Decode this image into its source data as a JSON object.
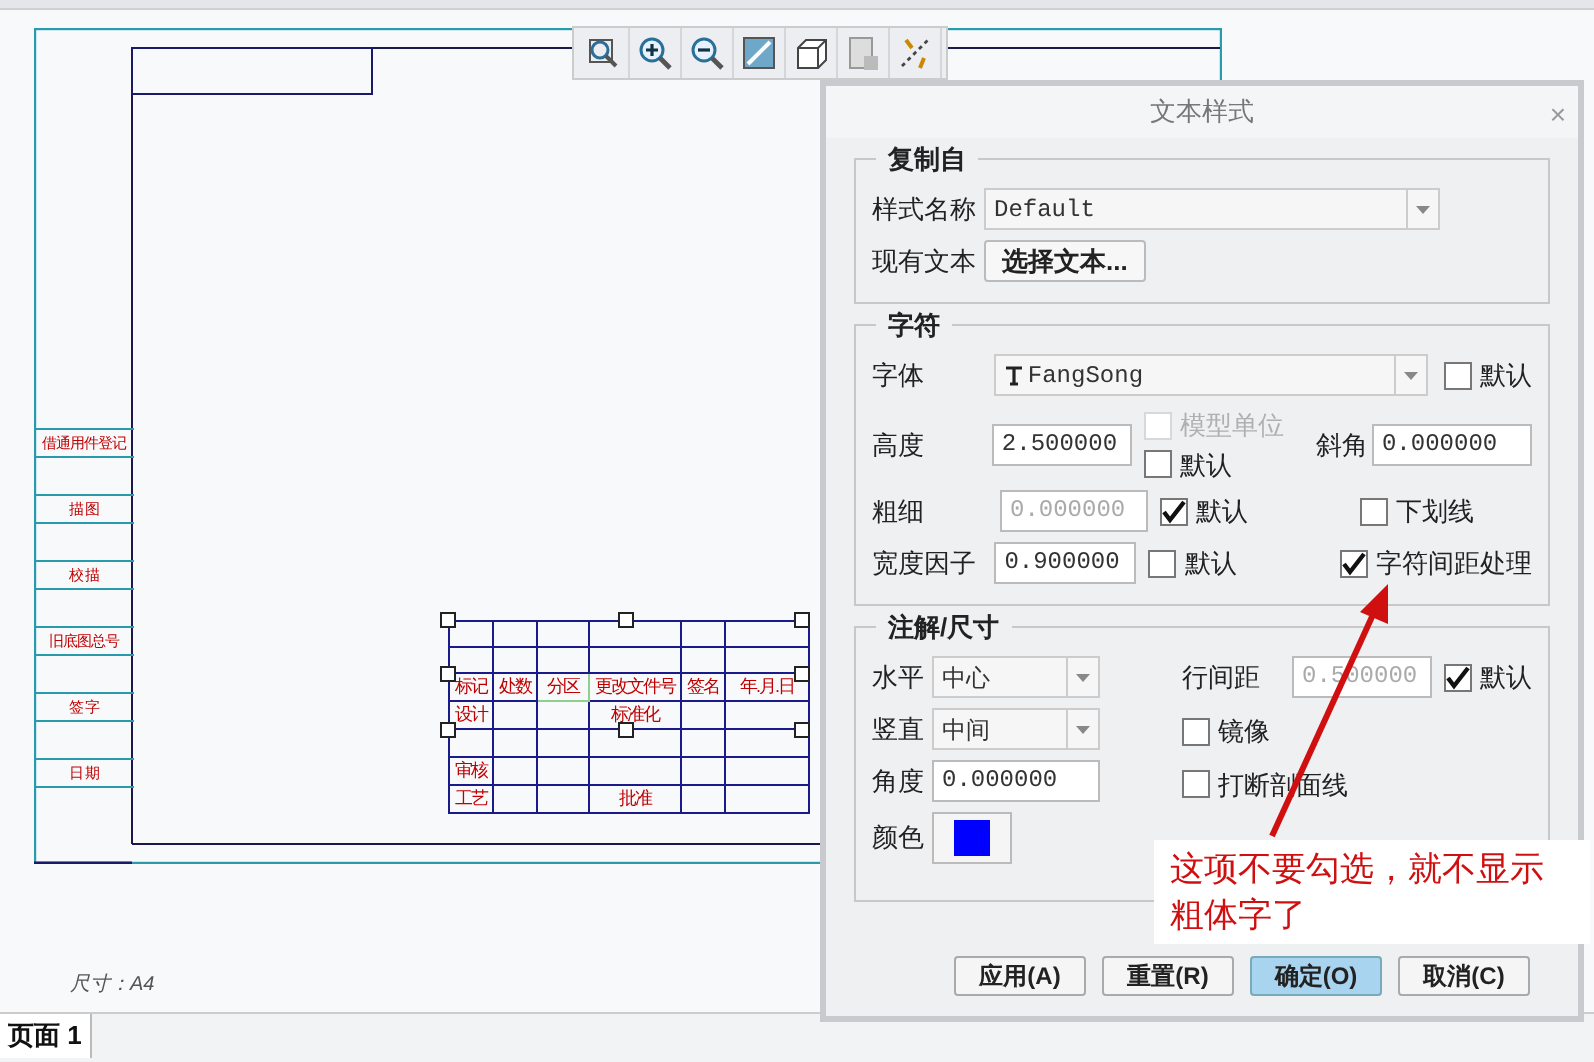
{
  "sheet": {
    "side_labels": [
      "借通用件登记",
      "描 图",
      "校 描",
      "旧底图总号",
      "签 字",
      "日 期"
    ],
    "title_block": {
      "header": [
        "标记",
        "处数",
        "分区",
        "更改文件号",
        "签名",
        "年.月.日"
      ],
      "rows": [
        [
          "设计",
          "",
          "",
          "标准化",
          "",
          ""
        ],
        [
          "",
          "",
          "",
          "",
          "",
          ""
        ],
        [
          "审核",
          "",
          "",
          "",
          "",
          ""
        ],
        [
          "工艺",
          "",
          "",
          "批准",
          "",
          ""
        ]
      ]
    },
    "size_label": "尺寸：A4"
  },
  "page_tabs": [
    {
      "label": "页面 1",
      "selected": true
    }
  ],
  "dialog": {
    "title": "文本样式",
    "close": "×",
    "copy_from": {
      "title": "复制自",
      "style_label": "样式名称",
      "style_value": "Default",
      "existing_label": "现有文本",
      "select_button": "选择文本..."
    },
    "character": {
      "title": "字符",
      "font_label": "字体",
      "font_value": "FangSong",
      "font_default": {
        "label": "默认",
        "checked": false
      },
      "height_label": "高度",
      "height_value": "2.500000",
      "model_units": {
        "label": "模型单位",
        "checked": false,
        "disabled": true
      },
      "height_default": {
        "label": "默认",
        "checked": false
      },
      "slant_label": "斜角",
      "slant_value": "0.000000",
      "thickness_label": "粗细",
      "thickness_value": "0.000000",
      "thickness_disabled": true,
      "thickness_default": {
        "label": "默认",
        "checked": true
      },
      "underline": {
        "label": "下划线",
        "checked": false
      },
      "width_label": "宽度因子",
      "width_value": "0.900000",
      "width_default": {
        "label": "默认",
        "checked": false
      },
      "kerning": {
        "label": "字符间距处理",
        "checked": true
      }
    },
    "note": {
      "title": "注解/尺寸",
      "horizontal_label": "水平",
      "horizontal_value": "中心",
      "vertical_label": "竖直",
      "vertical_value": "中间",
      "angle_label": "角度",
      "angle_value": "0.000000",
      "color_label": "颜色",
      "color": "#0000ff",
      "line_spacing_label": "行间距",
      "line_spacing_value": "0.500000",
      "line_spacing_disabled": true,
      "line_spacing_default": {
        "label": "默认",
        "checked": true
      },
      "mirror": {
        "label": "镜像",
        "checked": false
      },
      "break_hatch": {
        "label": "打断剖面线",
        "checked": false
      }
    },
    "buttons": [
      {
        "label": "应用(A)",
        "selected": false
      },
      {
        "label": "重置(R)",
        "selected": false
      },
      {
        "label": "确定(O)",
        "selected": true
      },
      {
        "label": "取消(C)",
        "selected": false
      }
    ]
  },
  "callout": {
    "text": "这项不要勾选，就不显示粗体字了"
  }
}
